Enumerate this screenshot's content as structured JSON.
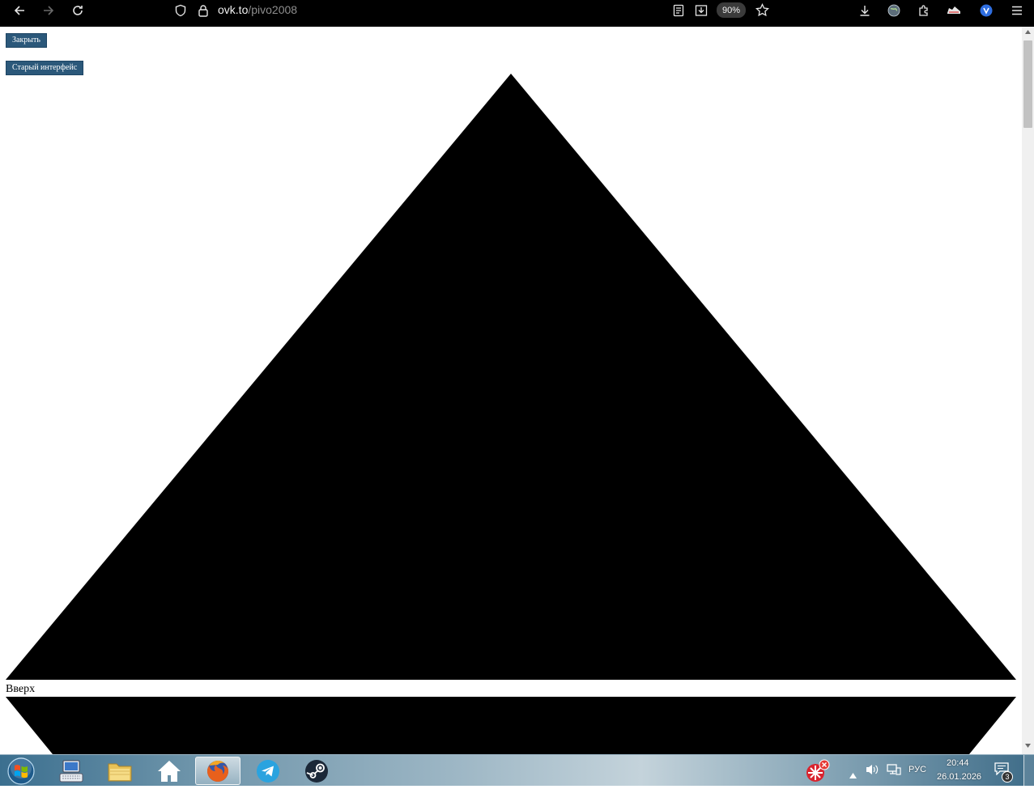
{
  "browser": {
    "url_host": "ovk.to",
    "url_path": "/pivo2008",
    "zoom": "90%"
  },
  "page": {
    "close_button": "Закрыть",
    "old_interface_button": "Старый интерфейс",
    "up_link": "Вверх"
  },
  "taskbar": {
    "apps": [
      "start-orb",
      "keyboard-icon",
      "folder-icon",
      "home-icon",
      "firefox-icon",
      "telegram-icon",
      "steam-icon"
    ],
    "active_app": "firefox-icon",
    "tray": {
      "language": "РУС",
      "time": "20:44",
      "date": "26.01.2026",
      "notifications": "3"
    }
  },
  "colors": {
    "toolbar_bg": "#000000",
    "button_bg": "#2b587a",
    "shape_fill": "#000000",
    "page_bg": "#ffffff"
  }
}
